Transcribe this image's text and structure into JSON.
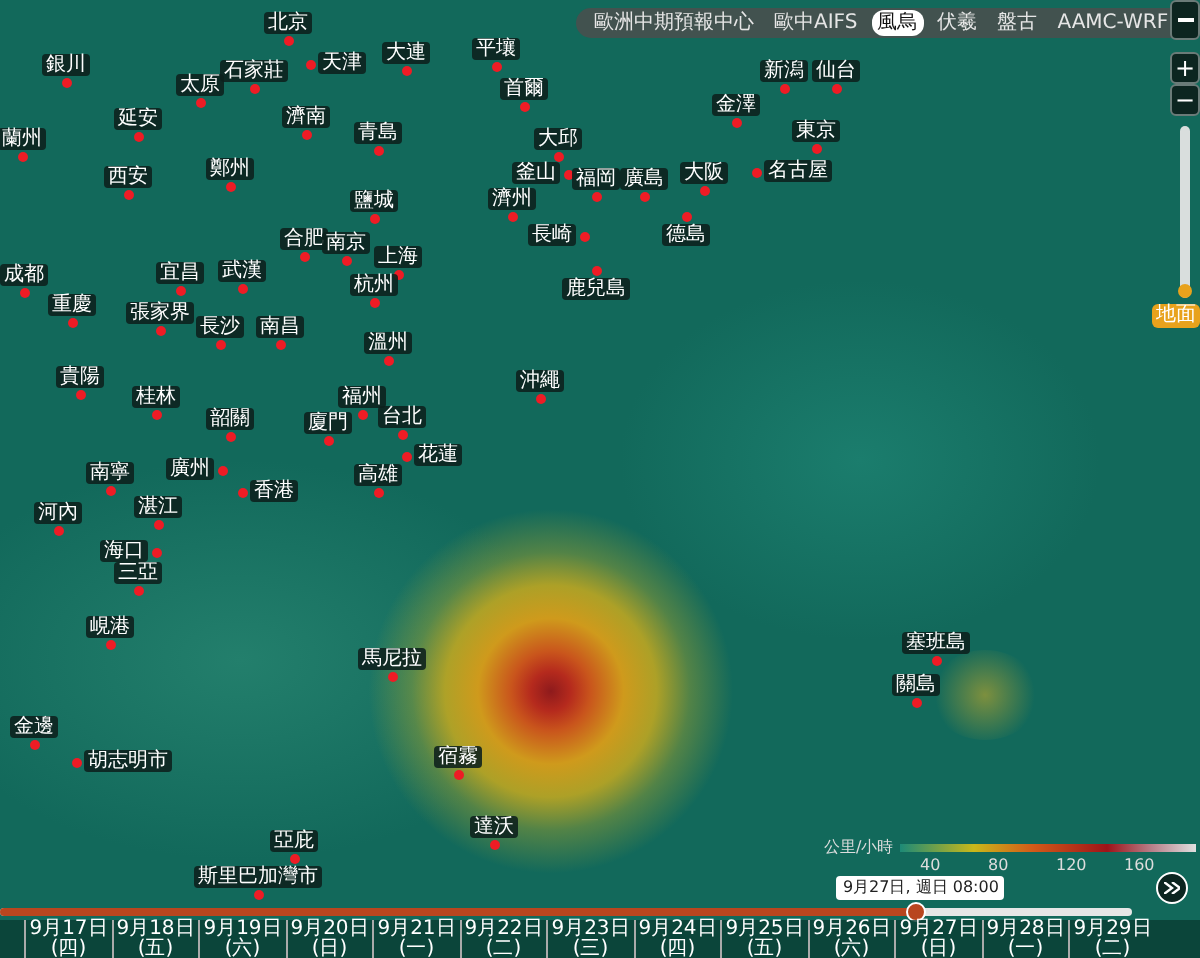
{
  "model_tabs": [
    {
      "label": "歐洲中期預報中心",
      "selected": false
    },
    {
      "label": "歐中AIFS",
      "selected": false
    },
    {
      "label": "風烏",
      "selected": true
    },
    {
      "label": "伏羲",
      "selected": false
    },
    {
      "label": "盤古",
      "selected": false
    },
    {
      "label": "AAMC-WRF",
      "selected": false
    }
  ],
  "zoom_controls": {
    "zoom_in": "+",
    "zoom_out": "−"
  },
  "altitude_slider": {
    "level": 0,
    "label": "地面"
  },
  "cities": [
    "北京",
    "大連",
    "平壤",
    "銀川",
    "石家莊",
    "天津",
    "新潟",
    "仙台",
    "太原",
    "首爾",
    "金澤",
    "延安",
    "濟南",
    "蘭州",
    "青島",
    "大邱",
    "東京",
    "西安",
    "鄭州",
    "釜山",
    "福岡",
    "廣島",
    "大阪",
    "名古屋",
    "鹽城",
    "濟州",
    "合肥",
    "南京",
    "長崎",
    "德島",
    "上海",
    "成都",
    "宜昌",
    "武漢",
    "杭州",
    "鹿兒島",
    "重慶",
    "張家界",
    "長沙",
    "南昌",
    "溫州",
    "貴陽",
    "沖繩",
    "桂林",
    "福州",
    "韶關",
    "廈門",
    "台北",
    "花蓮",
    "南寧",
    "廣州",
    "高雄",
    "香港",
    "河內",
    "湛江",
    "海口",
    "三亞",
    "峴港",
    "塞班島",
    "馬尼拉",
    "關島",
    "金邊",
    "胡志明市",
    "宿霧",
    "達沃",
    "亞庇",
    "斯里巴加灣市"
  ],
  "legend": {
    "unit": "公里/小時",
    "ticks": [
      "40",
      "80",
      "120",
      "160"
    ]
  },
  "timeline": {
    "level": 0.81,
    "tooltip": "9月27日, 週日 08:00",
    "days": [
      "9月17日 (四)",
      "9月18日 (五)",
      "9月19日 (六)",
      "9月20日 (日)",
      "9月21日 (一)",
      "9月22日 (二)",
      "9月23日 (三)",
      "9月24日 (四)",
      "9月25日 (五)",
      "9月26日 (六)",
      "9月27日 (日)",
      "9月28日 (一)",
      "9月29日 (二)"
    ]
  }
}
